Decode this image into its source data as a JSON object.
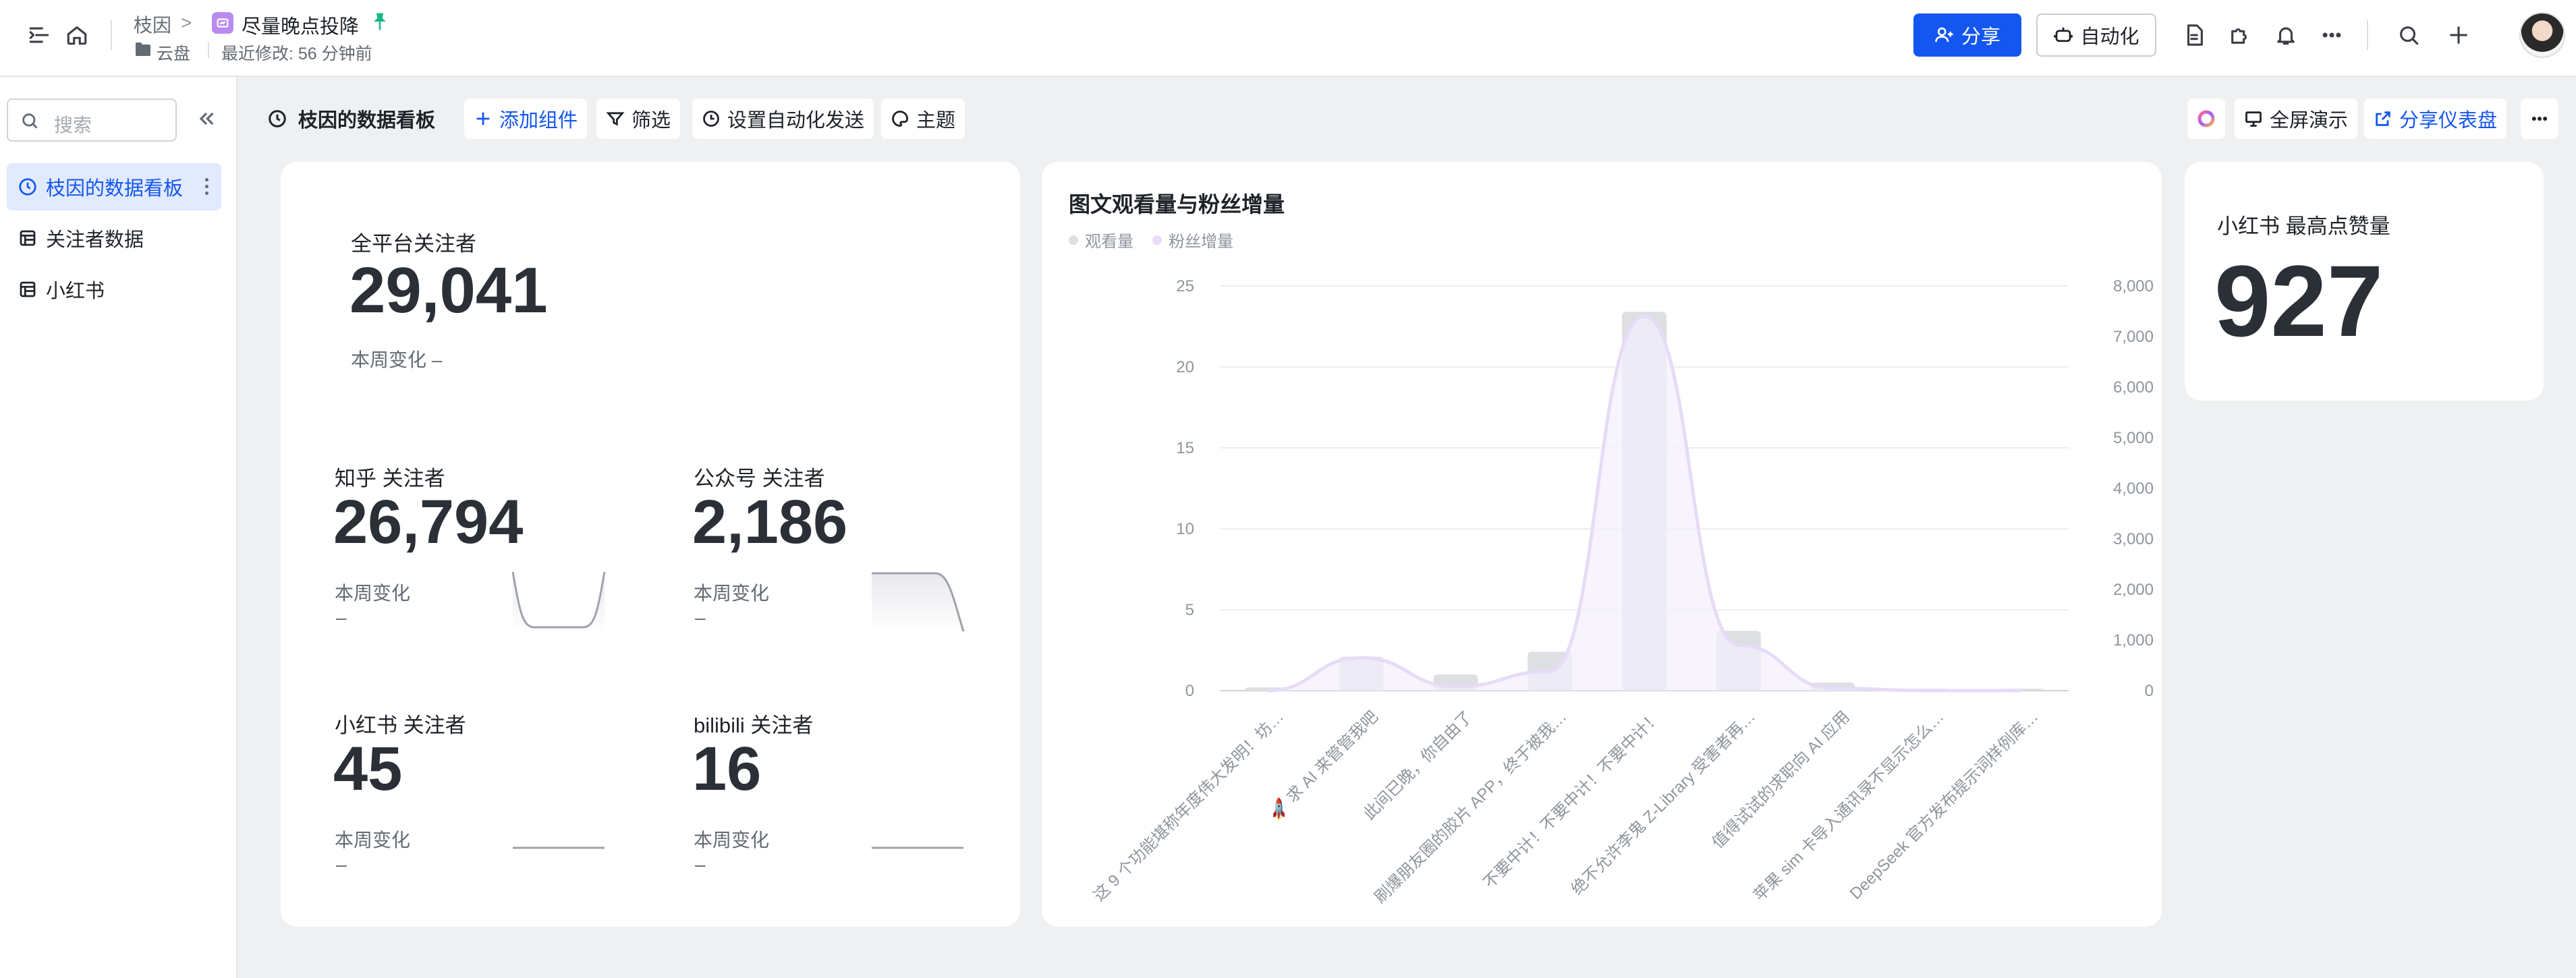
{
  "topbar": {
    "breadcrumb_root": "枝因",
    "breadcrumb_sep": ">",
    "doc_title": "尽量晚点投降",
    "location": "云盘",
    "last_modified": "最近修改: 56 分钟前",
    "share_label": "分享",
    "automation_label": "自动化"
  },
  "sidebar": {
    "search_placeholder": "搜索",
    "items": [
      {
        "label": "枝因的数据看板",
        "active": true
      },
      {
        "label": "关注者数据",
        "active": false
      },
      {
        "label": "小红书",
        "active": false
      }
    ]
  },
  "toolbar": {
    "title": "枝因的数据看板",
    "add_component": "添加组件",
    "filter": "筛选",
    "auto_send": "设置自动化发送",
    "theme": "主题",
    "fullscreen": "全屏演示",
    "share_dashboard": "分享仪表盘"
  },
  "followers": {
    "total_label": "全平台关注者",
    "total_value": "29,041",
    "total_change_label": "本周变化 –",
    "platforms": [
      {
        "label": "知乎 关注者",
        "value": "26,794",
        "change_label": "本周变化",
        "change_value": "–"
      },
      {
        "label": "公众号 关注者",
        "value": "2,186",
        "change_label": "本周变化",
        "change_value": "–"
      },
      {
        "label": "小红书 关注者",
        "value": "45",
        "change_label": "本周变化",
        "change_value": "–"
      },
      {
        "label": "bilibili 关注者",
        "value": "16",
        "change_label": "本周变化",
        "change_value": "–"
      }
    ]
  },
  "xhs_max_likes": {
    "label": "小红书 最高点赞量",
    "value": "927"
  },
  "colors": {
    "accent": "#1456f0",
    "bar": "#dedfe3",
    "line": "#e6dcf7",
    "line_fill": "#f4effc"
  },
  "chart_data": {
    "type": "bar",
    "title": "图文观看量与粉丝增量",
    "legend_placement": "top-left",
    "grid": true,
    "categories": [
      "这 9 个功能堪称年度伟大发明！坊…",
      "🚀 求 AI 来管管我吧",
      "此间已晚，你自由了",
      "刷爆朋友圈的胶片 APP，终于被我…",
      "不要中计！不要中计！不要中计！",
      "绝不允许李鬼 Z-Library 受害者再…",
      "值得试试的求职向 AI 应用",
      "苹果 sim 卡导入通讯录不显示怎么…",
      "DeepSeek 官方发布提示词样例库…"
    ],
    "series": [
      {
        "name": "观看量",
        "axis": "left",
        "values": [
          0.2,
          2.1,
          1.0,
          2.4,
          23.4,
          3.7,
          0.5,
          0.1,
          0.1
        ]
      },
      {
        "name": "粉丝增量",
        "axis": "right",
        "values": [
          0,
          650,
          80,
          380,
          7400,
          900,
          50,
          0,
          0
        ]
      }
    ],
    "y_left": {
      "min": 0,
      "max": 25,
      "ticks": [
        "0",
        "5",
        "10",
        "15",
        "20",
        "25"
      ]
    },
    "y_right": {
      "min": 0,
      "max": 8000,
      "ticks": [
        "0",
        "1,000",
        "2,000",
        "3,000",
        "4,000",
        "5,000",
        "6,000",
        "7,000",
        "8,000"
      ]
    }
  }
}
